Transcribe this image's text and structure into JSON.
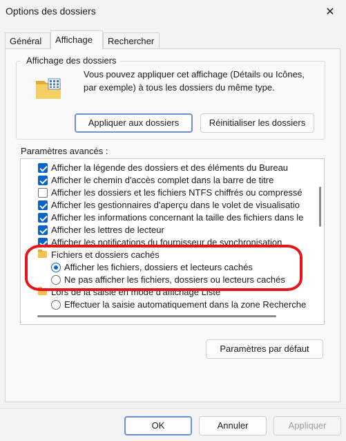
{
  "window": {
    "title": "Options des dossiers"
  },
  "tabs": [
    {
      "label": "Général",
      "active": false
    },
    {
      "label": "Affichage",
      "active": true
    },
    {
      "label": "Rechercher",
      "active": false
    }
  ],
  "folder_view": {
    "legend": "Affichage des dossiers",
    "description": "Vous pouvez appliquer cet affichage (Détails ou Icônes, par exemple) à tous les dossiers du même type.",
    "apply_label": "Appliquer aux dossiers",
    "reset_label": "Réinitialiser les dossiers"
  },
  "advanced": {
    "label": "Paramètres avancés :",
    "items": [
      {
        "type": "checkbox",
        "checked": true,
        "label": "Afficher la légende des dossiers et des éléments du Bureau"
      },
      {
        "type": "checkbox",
        "checked": true,
        "label": "Afficher le chemin d'accès complet dans la barre de titre"
      },
      {
        "type": "checkbox",
        "checked": false,
        "label": "Afficher les dossiers et les fichiers NTFS chiffrés ou compressé"
      },
      {
        "type": "checkbox",
        "checked": true,
        "label": "Afficher les gestionnaires d'aperçu dans le volet de visualisatio"
      },
      {
        "type": "checkbox",
        "checked": true,
        "label": "Afficher les informations concernant la taille des fichiers dans le"
      },
      {
        "type": "checkbox",
        "checked": true,
        "label": "Afficher les lettres de lecteur"
      },
      {
        "type": "checkbox",
        "checked": true,
        "label": "Afficher les notifications du fournisseur de synchronisation"
      },
      {
        "type": "folder",
        "label": "Fichiers et dossiers cachés"
      },
      {
        "type": "radio",
        "checked": true,
        "label": "Afficher les fichiers, dossiers et lecteurs cachés"
      },
      {
        "type": "radio",
        "checked": false,
        "label": "Ne pas afficher les fichiers, dossiers ou lecteurs cachés"
      },
      {
        "type": "folder",
        "label": "Lors de la saisie en mode d'affichage Liste"
      },
      {
        "type": "radio",
        "checked": true,
        "label": "Effectuer la saisie automatiquement dans la zone Recherche"
      }
    ],
    "defaults_label": "Paramètres par défaut"
  },
  "footer": {
    "ok_label": "OK",
    "cancel_label": "Annuler",
    "apply_label": "Appliquer"
  },
  "colors": {
    "accent": "#0a63c9",
    "highlight": "#e8141b",
    "folder": "#f2c14e"
  }
}
